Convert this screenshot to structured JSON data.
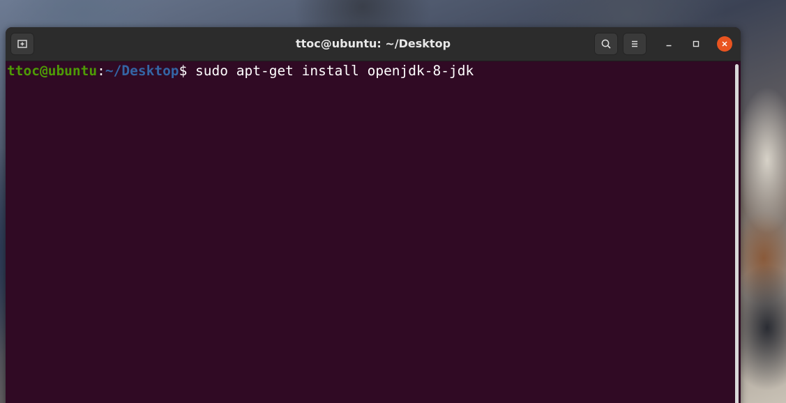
{
  "window": {
    "title": "ttoc@ubuntu: ~/Desktop"
  },
  "titlebar": {
    "buttons": [
      {
        "name": "new-tab",
        "icon": "new-tab-icon"
      },
      {
        "name": "search",
        "icon": "search-icon"
      },
      {
        "name": "menu",
        "icon": "hamburger-menu-icon"
      },
      {
        "name": "minimize",
        "icon": "minimize-icon"
      },
      {
        "name": "maximize",
        "icon": "maximize-icon"
      },
      {
        "name": "close",
        "icon": "close-icon"
      }
    ]
  },
  "terminal": {
    "prompt_user": "ttoc@ubuntu",
    "prompt_colon": ":",
    "prompt_path": "~/Desktop",
    "prompt_sign": "$ ",
    "command": "sudo apt-get install openjdk-8-jdk"
  },
  "colors": {
    "terminal_bg": "#300a24",
    "prompt_user": "#4e9a06",
    "prompt_path": "#3465a4",
    "close_button": "#e95420",
    "titlebar_bg": "#2c2c2c"
  }
}
